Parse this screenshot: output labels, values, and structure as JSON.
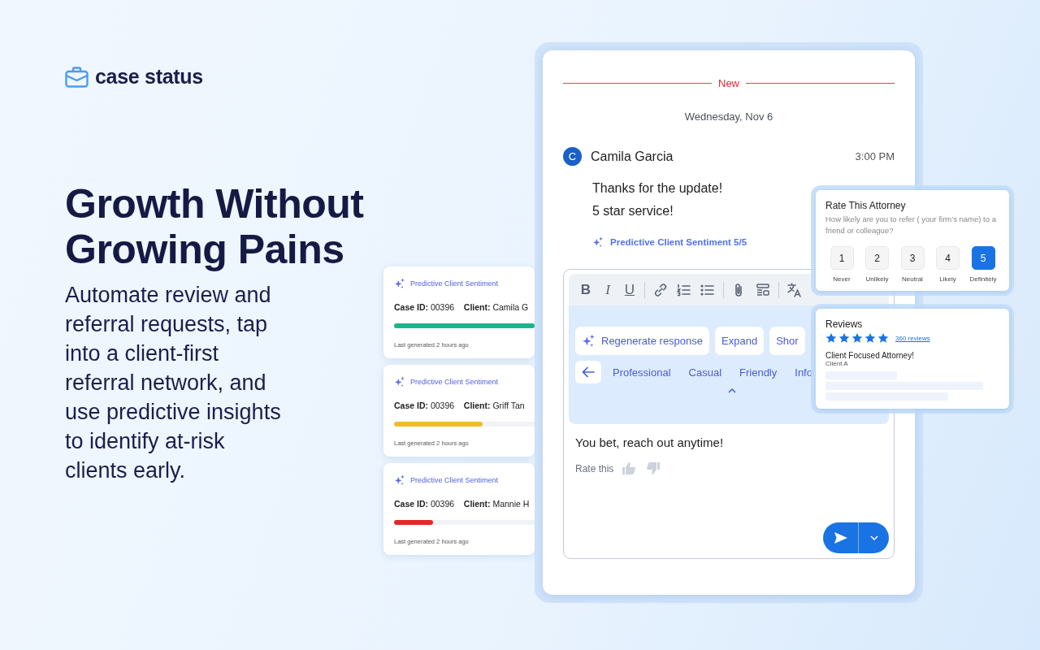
{
  "logo": {
    "text": "case status"
  },
  "headline": "Growth Without Growing Pains",
  "description": "Automate review and referral requests, tap into a client-first referral network, and use predictive insights to identify at-risk clients early.",
  "sentiment_cards": [
    {
      "title": "Predictive Client Sentiment",
      "case_label": "Case ID:",
      "case_id": "00396",
      "client_label": "Client:",
      "client": "Camila G",
      "level": 1,
      "color": "#1db48d",
      "footer": "Last generated 2 hours ago"
    },
    {
      "title": "Predictive Client Sentiment",
      "case_label": "Case ID:",
      "case_id": "00396",
      "client_label": "Client:",
      "client": "Griff Tan",
      "level": 0.63,
      "color": "#efbd2b",
      "footer": "Last generated 2 hours ago"
    },
    {
      "title": "Predictive Client Sentiment",
      "case_label": "Case ID:",
      "case_id": "00396",
      "client_label": "Client:",
      "client": "Mannie H",
      "level": 0.28,
      "color": "#e02a2a",
      "footer": "Last generated 2 hours ago"
    }
  ],
  "chat": {
    "divider": "New",
    "date": "Wednesday, Nov 6",
    "message": {
      "avatar": "C",
      "sender": "Camila Garcia",
      "time": "3:00 PM",
      "lines": [
        "Thanks for the update!",
        "5 star service!"
      ],
      "sentiment": "Predictive Client Sentiment 5/5"
    },
    "editor": {
      "toolbar": [
        {
          "kind": "bold",
          "glyph": "B"
        },
        {
          "kind": "italic",
          "glyph": "I"
        },
        {
          "kind": "underline",
          "glyph": "U"
        },
        {
          "kind": "separator"
        },
        {
          "kind": "link"
        },
        {
          "kind": "numbered-list"
        },
        {
          "kind": "bullet-list"
        },
        {
          "kind": "separator"
        },
        {
          "kind": "attach"
        },
        {
          "kind": "template"
        },
        {
          "kind": "separator"
        },
        {
          "kind": "translate"
        }
      ],
      "actions": [
        {
          "label": "Regenerate response",
          "kind": "ai"
        },
        {
          "label": "Expand",
          "kind": "plain"
        },
        {
          "label": "Shor",
          "kind": "plain"
        }
      ],
      "tones": [
        "Professional",
        "Casual",
        "Friendly",
        "Info"
      ],
      "draft": "You bet, reach out anytime!",
      "rate_label": "Rate this"
    }
  },
  "rating": {
    "title": "Rate This Attorney",
    "question": "How likely are you to refer ( your firm’s name) to a friend or colleague?",
    "options": [
      {
        "value": "1",
        "label": "Never",
        "selected": false
      },
      {
        "value": "2",
        "label": "Unlikely",
        "selected": false
      },
      {
        "value": "3",
        "label": "Neutral",
        "selected": false
      },
      {
        "value": "4",
        "label": "Likely",
        "selected": false
      },
      {
        "value": "5",
        "label": "Definitely",
        "selected": true
      }
    ]
  },
  "reviews": {
    "title": "Reviews",
    "stars": 5,
    "count": "360 reviews",
    "review_title": "Client Focused Attorney!",
    "reviewer": "Client A"
  }
}
